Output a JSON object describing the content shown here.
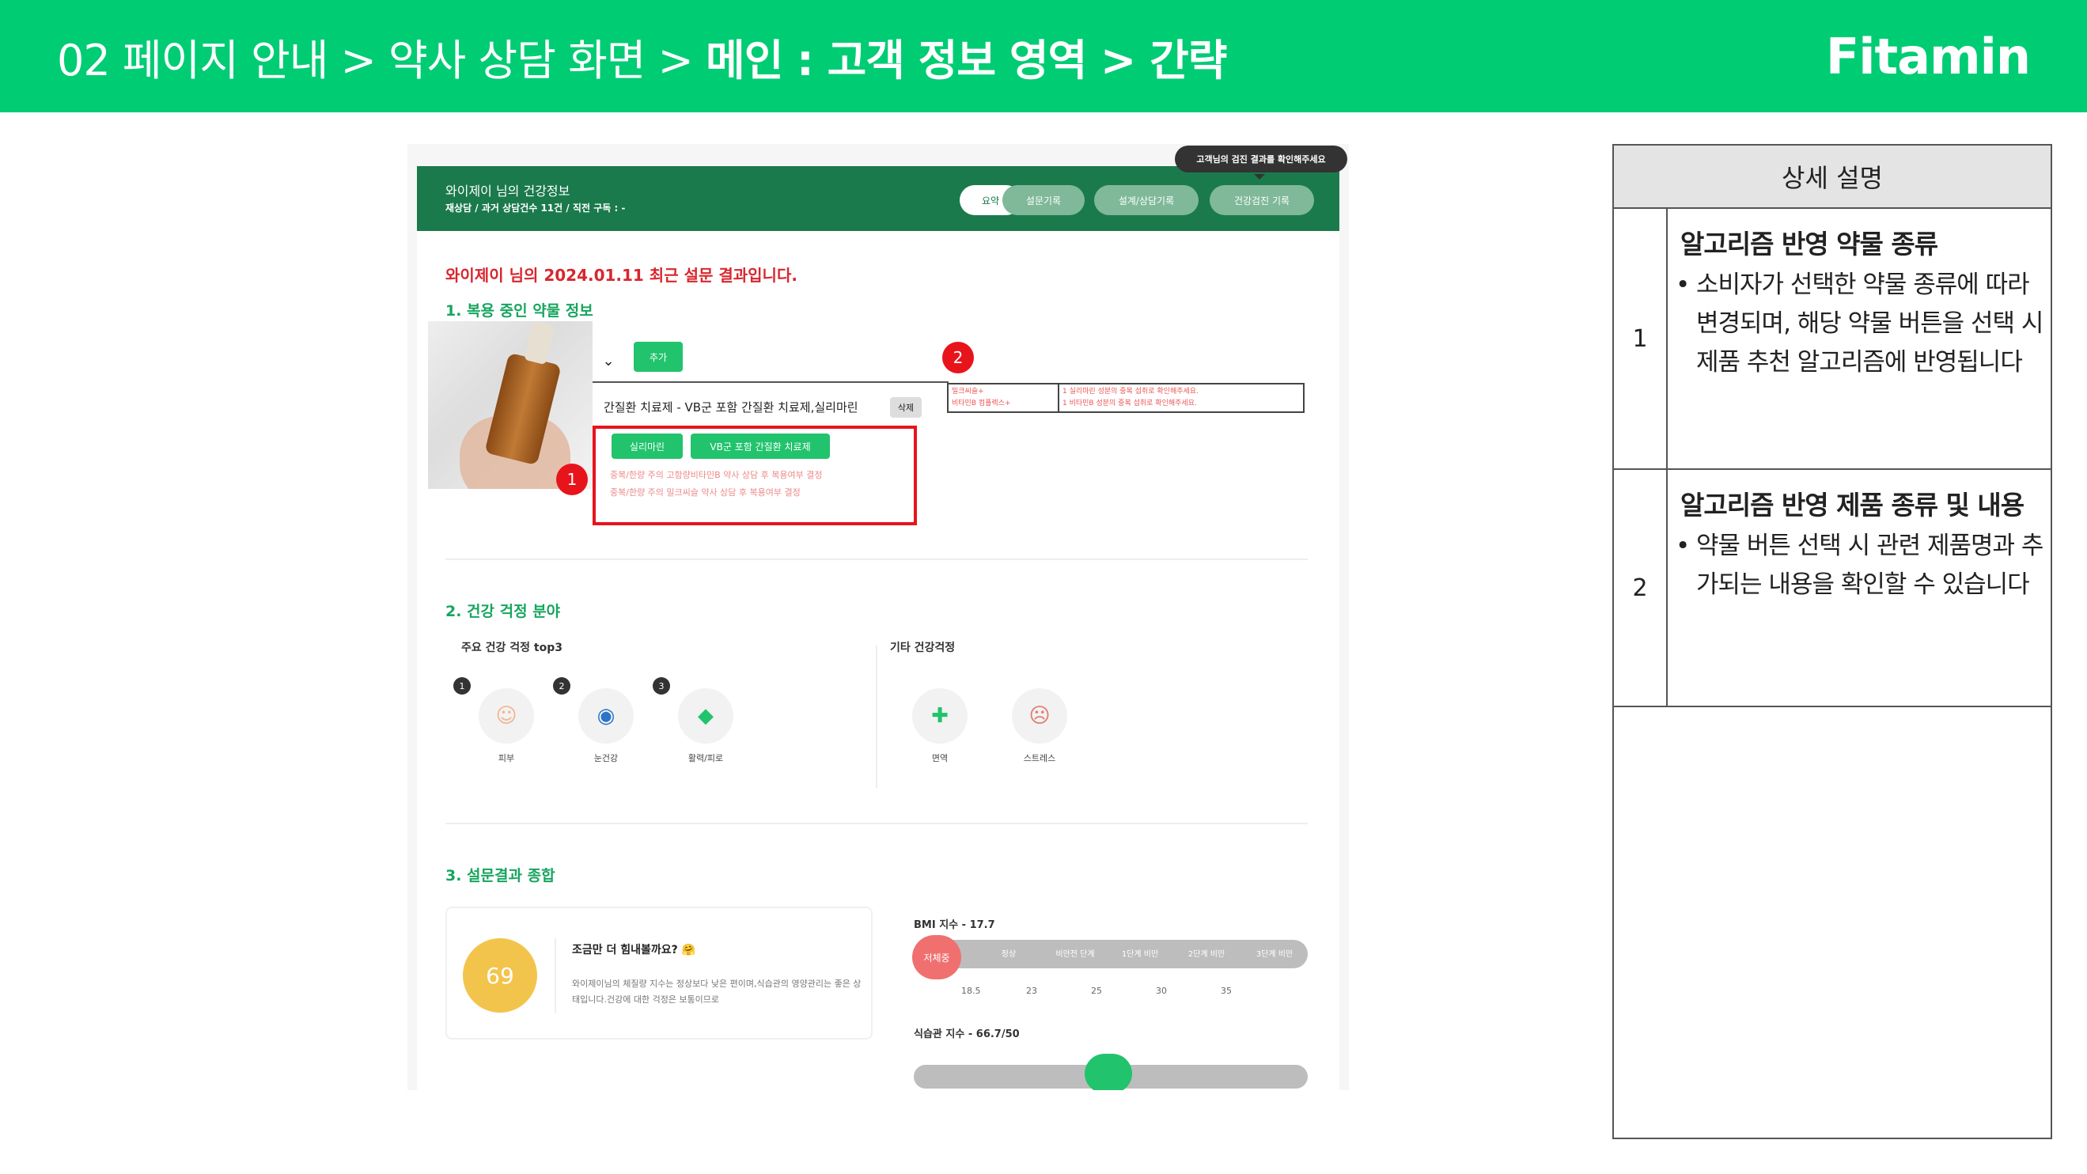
{
  "header": {
    "breadcrumb_plain": "02 페이지 안내 > 약사 상담 화면 > ",
    "breadcrumb_bold": "메인 : 고객 정보 영역 > 간략",
    "logo": "Fitamin",
    "brand_color": "#00cc74"
  },
  "screenshot": {
    "tooltip": "고객님의 검진 결과를 확인해주세요",
    "profile_title": "와이제이 님의 건강정보",
    "profile_sub": "재상담 / 과거 상담건수 11건 / 직전 구독 : -",
    "tabs": [
      "요약",
      "설문기록",
      "설계/상담기록",
      "건강검진 기록"
    ],
    "survey_title": "와이제이 님의 2024.01.11 최근 설문 결과입니다.",
    "section1": "1. 복용 중인 약물 정보",
    "add_button": "추가",
    "med_entry": "간질환 치료제 - VB군 포함 간질환 치료제,실리마린",
    "delete_button": "삭제",
    "chips": [
      "실리마린",
      "VB군 포함 간질환 치료제"
    ],
    "warnings": [
      "중복/한량 주의 고함량비타민B 약사 상담 후 복용여부 결정",
      "중복/한량 주의 밀크씨슬 약사 상담 후 복용여부 결정"
    ],
    "reco_table": [
      [
        "밀크씨슬+",
        "1 실리마린 성분의 중복 섭취로 확인해주세요."
      ],
      [
        "비타민B 컴플렉스+",
        "1 비타민B 성분의 중복 섭취로 확인해주세요."
      ]
    ],
    "badges": [
      "1",
      "2"
    ],
    "section2": "2. 건강 걱정 분야",
    "top3_label": "주요 건강 걱정 top3",
    "other_label": "기타 건강걱정",
    "top3": [
      {
        "rank": "1",
        "label": "피부",
        "icon": "face-icon"
      },
      {
        "rank": "2",
        "label": "눈건강",
        "icon": "eye-icon"
      },
      {
        "rank": "3",
        "label": "활력/피로",
        "icon": "energy-icon"
      }
    ],
    "others": [
      {
        "label": "면역",
        "icon": "immunity-icon"
      },
      {
        "label": "스트레스",
        "icon": "stress-icon"
      }
    ],
    "section3": "3. 설문결과 종합",
    "score": "69",
    "score_title": "조금만 더 힘내볼까요? 🤗",
    "score_text": "와이제이님의 체질량 지수는 정상보다 낮은 편이며,식습관의 영양관리는 좋은 상태입니다.건강에 대한 걱정은 보통이므로",
    "bmi_label": "BMI 지수 - 17.7",
    "bmi_segments": [
      "저체중",
      "정상",
      "비만전 단계",
      "1단계 비만",
      "2단계 비만",
      "3단계 비만"
    ],
    "bmi_ticks": [
      "18.5",
      "23",
      "25",
      "30",
      "35"
    ],
    "habit_label": "식습관 지수 - 66.7/50"
  },
  "side": {
    "header": "상세 설명",
    "rows": [
      {
        "num": "1",
        "title": "알고리즘 반영 약물 종류",
        "bullet": "소비자가 선택한 약물 종류에 따라 변경되며, 해당 약물 버튼을 선택 시 제품 추천 알고리즘에 반영됩니다"
      },
      {
        "num": "2",
        "title": "알고리즘 반영 제품 종류 및 내용",
        "bullet": "약물 버튼 선택 시 관련 제품명과 추가되는 내용을 확인할 수 있습니다"
      }
    ]
  }
}
